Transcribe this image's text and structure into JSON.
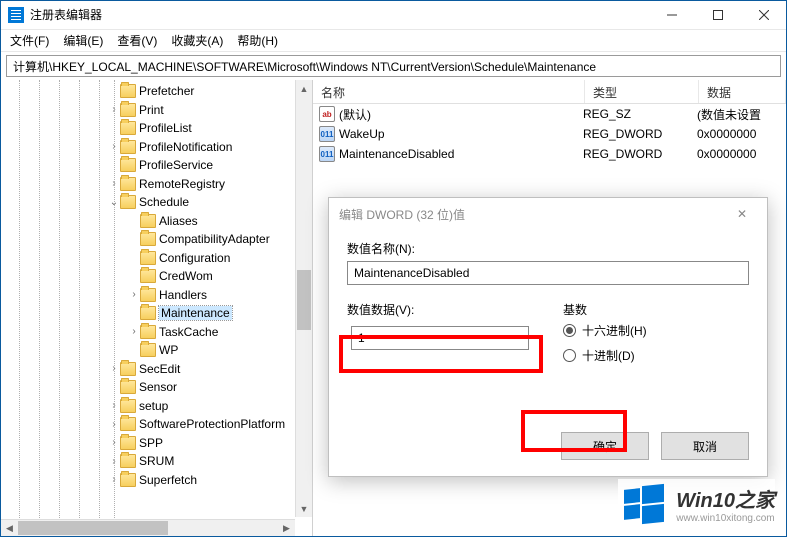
{
  "window": {
    "title": "注册表编辑器"
  },
  "menu": {
    "file": "文件(F)",
    "edit": "编辑(E)",
    "view": "查看(V)",
    "fav": "收藏夹(A)",
    "help": "帮助(H)"
  },
  "address": "计算机\\HKEY_LOCAL_MACHINE\\SOFTWARE\\Microsoft\\Windows NT\\CurrentVersion\\Schedule\\Maintenance",
  "tree": [
    {
      "indent": 107,
      "toggle": "",
      "label": "Prefetcher"
    },
    {
      "indent": 107,
      "toggle": ">",
      "label": "Print"
    },
    {
      "indent": 107,
      "toggle": "",
      "label": "ProfileList"
    },
    {
      "indent": 107,
      "toggle": ">",
      "label": "ProfileNotification"
    },
    {
      "indent": 107,
      "toggle": "",
      "label": "ProfileService"
    },
    {
      "indent": 107,
      "toggle": ">",
      "label": "RemoteRegistry"
    },
    {
      "indent": 107,
      "toggle": "v",
      "label": "Schedule"
    },
    {
      "indent": 127,
      "toggle": "",
      "label": "Aliases"
    },
    {
      "indent": 127,
      "toggle": "",
      "label": "CompatibilityAdapter"
    },
    {
      "indent": 127,
      "toggle": "",
      "label": "Configuration"
    },
    {
      "indent": 127,
      "toggle": "",
      "label": "CredWom"
    },
    {
      "indent": 127,
      "toggle": ">",
      "label": "Handlers"
    },
    {
      "indent": 127,
      "toggle": "",
      "label": "Maintenance",
      "selected": true
    },
    {
      "indent": 127,
      "toggle": ">",
      "label": "TaskCache"
    },
    {
      "indent": 127,
      "toggle": "",
      "label": "WP"
    },
    {
      "indent": 107,
      "toggle": ">",
      "label": "SecEdit"
    },
    {
      "indent": 107,
      "toggle": "",
      "label": "Sensor"
    },
    {
      "indent": 107,
      "toggle": ">",
      "label": "setup"
    },
    {
      "indent": 107,
      "toggle": ">",
      "label": "SoftwareProtectionPlatform"
    },
    {
      "indent": 107,
      "toggle": ">",
      "label": "SPP"
    },
    {
      "indent": 107,
      "toggle": ">",
      "label": "SRUM"
    },
    {
      "indent": 107,
      "toggle": ">",
      "label": "Superfetch"
    }
  ],
  "list": {
    "cols": {
      "name": "名称",
      "type": "类型",
      "data": "数据"
    },
    "rows": [
      {
        "icon": "str",
        "name": "(默认)",
        "type": "REG_SZ",
        "data": "(数值未设置"
      },
      {
        "icon": "dw",
        "name": "WakeUp",
        "type": "REG_DWORD",
        "data": "0x0000000"
      },
      {
        "icon": "dw",
        "name": "MaintenanceDisabled",
        "type": "REG_DWORD",
        "data": "0x0000000"
      }
    ]
  },
  "dialog": {
    "title": "编辑 DWORD (32 位)值",
    "name_label": "数值名称(N):",
    "name_value": "MaintenanceDisabled",
    "data_label": "数值数据(V):",
    "data_value": "1",
    "base_label": "基数",
    "radio_hex": "十六进制(H)",
    "radio_dec": "十进制(D)",
    "ok": "确定",
    "cancel": "取消"
  },
  "watermark": {
    "title": "Win10之家",
    "url": "www.win10xitong.com"
  }
}
